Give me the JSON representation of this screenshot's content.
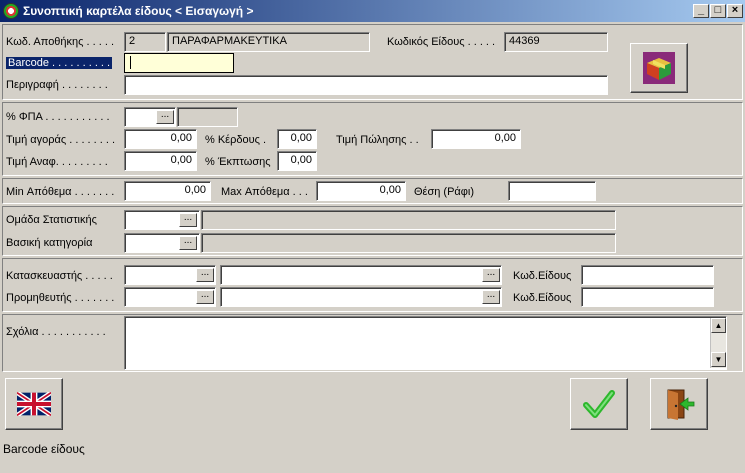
{
  "window": {
    "title": "Συνοπτική καρτέλα είδους < Εισαγωγή >",
    "min_label": "_",
    "max_label": "□",
    "close_label": "×"
  },
  "header": {
    "warehouse_code_label": "Κωδ. Αποθήκης . . . . .",
    "warehouse_code_value": "2",
    "warehouse_name_value": "ΠΑΡΑΦΑΡΜΑΚΕΥΤΙΚΑ",
    "item_code_label": "Κωδικός Είδους . . . . .",
    "item_code_value": "44369",
    "barcode_label": "Barcode . . . . . . . . . .",
    "barcode_value": "",
    "description_label": "Περιγραφή . . . . . . . .",
    "description_value": ""
  },
  "pricing": {
    "vat_label": "% ΦΠΑ . . . . . . . . . . .",
    "vat_value": "",
    "vat_desc": "",
    "purchase_price_label": "Τιμή αγοράς . . . . . . . .",
    "purchase_price_value": "0,00",
    "profit_label": "% Κέρδους .",
    "profit_value": "0,00",
    "sale_price_label": "Τιμή Πώλησης . .",
    "sale_price_value": "0,00",
    "ref_price_label": "Τιμή Αναφ. . . . . . . . .",
    "ref_price_value": "0,00",
    "discount_label": "% Έκπτωσης",
    "discount_value": "0,00"
  },
  "stock": {
    "min_label": "Min Απόθεμα . . . . . . .",
    "min_value": "0,00",
    "max_label": "Max Απόθεμα . . .",
    "max_value": "0,00",
    "shelf_label": "Θέση (Ράφι)",
    "shelf_value": ""
  },
  "groups": {
    "stat_group_label": "Ομάδα Στατιστικής",
    "stat_group_value": "",
    "base_category_label": "Βασική κατηγορία",
    "base_category_value": ""
  },
  "vendors": {
    "manufacturer_label": "Κατασκευαστής . . . . .",
    "supplier_label": "Προμηθευτής . . . . . . .",
    "item_code_label_1": "Κωδ.Είδους",
    "item_code_label_2": "Κωδ.Είδους"
  },
  "comments": {
    "label": "Σχόλια . . . . . . . . . . .",
    "value": ""
  },
  "buttons": {
    "dots": "...",
    "scroll_up": "▲",
    "scroll_down": "▼"
  },
  "status": {
    "text": "Barcode είδους"
  },
  "colors": {
    "titlebar_start": "#0a246a",
    "titlebar_end": "#a6caf0",
    "face": "#d4d0c8",
    "check_green": "#2db82d"
  }
}
